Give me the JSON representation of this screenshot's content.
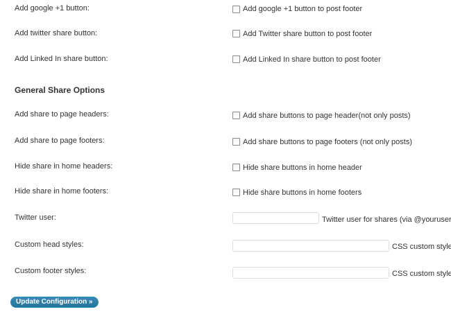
{
  "rows": [
    {
      "label": "Add google +1 button:",
      "checkbox_text": "Add google +1 button to post footer"
    },
    {
      "label": "Add twitter share button:",
      "checkbox_text": "Add Twitter share button to post footer"
    },
    {
      "label": "Add Linked In share button:",
      "checkbox_text": "Add Linked In share button to post footer"
    }
  ],
  "section_title": "General Share Options",
  "general_rows": [
    {
      "label": "Add share to page headers:",
      "checkbox_text": "Add share buttons to page header(not only posts)"
    },
    {
      "label": "Add share to page footers:",
      "checkbox_text": "Add share buttons to page footers (not only posts)"
    },
    {
      "label": "Hide share in home headers:",
      "checkbox_text": "Hide share buttons in home header"
    },
    {
      "label": "Hide share in home footers:",
      "checkbox_text": "Hide share buttons in home footers"
    }
  ],
  "fields": [
    {
      "label": "Twitter user:",
      "value": "",
      "help": "Twitter user for shares (via @youruser)"
    },
    {
      "label": "Custom head styles:",
      "value": "",
      "help": "CSS custom styles"
    },
    {
      "label": "Custom footer styles:",
      "value": "",
      "help": "CSS custom styles"
    }
  ],
  "submit_label": "Update Configuration »"
}
